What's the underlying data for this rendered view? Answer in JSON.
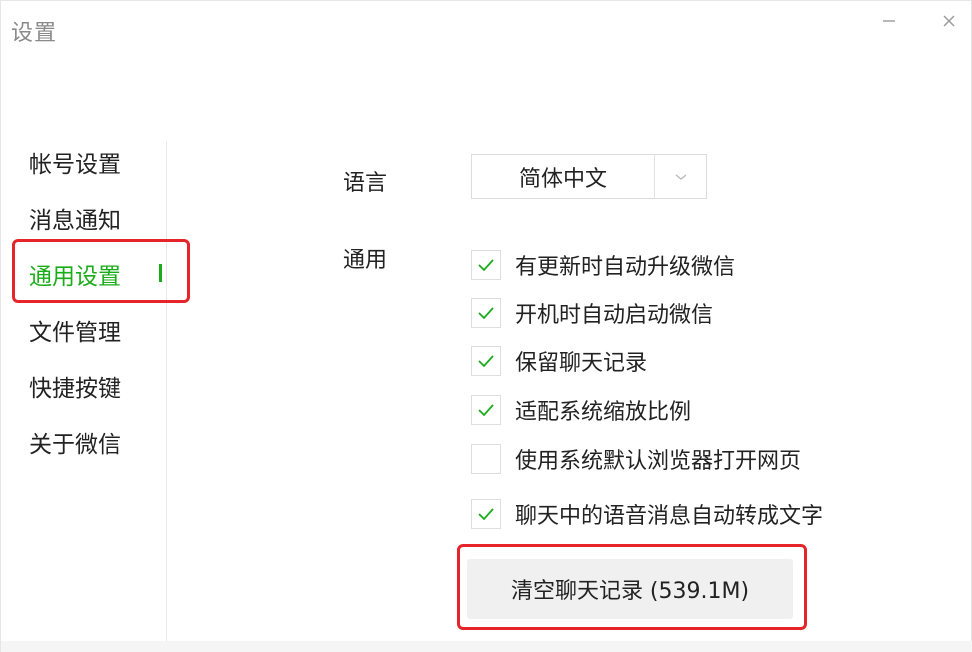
{
  "window": {
    "title": "设置",
    "minimize_icon": "minimize-icon",
    "close_icon": "close-icon"
  },
  "sidebar": {
    "items": [
      {
        "label": "帐号设置"
      },
      {
        "label": "消息通知"
      },
      {
        "label": "通用设置",
        "active": true
      },
      {
        "label": "文件管理"
      },
      {
        "label": "快捷按键"
      },
      {
        "label": "关于微信"
      }
    ]
  },
  "general": {
    "language_label": "语言",
    "language_value": "简体中文",
    "general_label": "通用",
    "options": [
      {
        "label": "有更新时自动升级微信",
        "checked": true
      },
      {
        "label": "开机时自动启动微信",
        "checked": true
      },
      {
        "label": "保留聊天记录",
        "checked": true
      },
      {
        "label": "适配系统缩放比例",
        "checked": true
      },
      {
        "label": "使用系统默认浏览器打开网页",
        "checked": false
      },
      {
        "label": "聊天中的语音消息自动转成文字",
        "checked": true
      }
    ],
    "clear_button_label": "清空聊天记录 (539.1M)"
  },
  "colors": {
    "accent": "#1aad19",
    "highlight": "#e5252a"
  }
}
